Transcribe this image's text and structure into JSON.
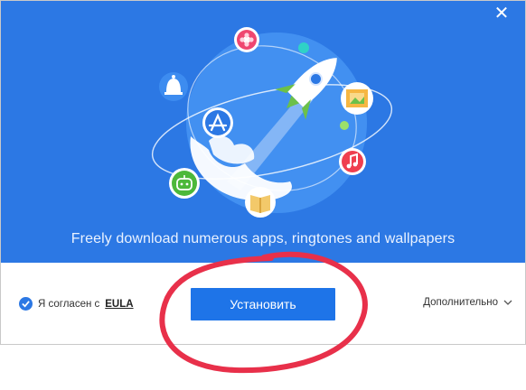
{
  "window": {
    "close_icon": "close-icon",
    "tagline": "Freely download numerous apps, ringtones and wallpapers"
  },
  "hero": {
    "icons": [
      "flower-icon",
      "bell-icon",
      "app-store-icon",
      "robot-icon",
      "book-icon",
      "music-icon",
      "film-icon",
      "rocket-icon"
    ]
  },
  "footer": {
    "agree_text": "Я согласен с",
    "eula_label": "EULA",
    "install_label": "Установить",
    "more_label": "Дополнительно"
  },
  "colors": {
    "hero_bg": "#2c78e4",
    "button_blue": "#1e74e8",
    "annotation_red": "#e8304a"
  }
}
